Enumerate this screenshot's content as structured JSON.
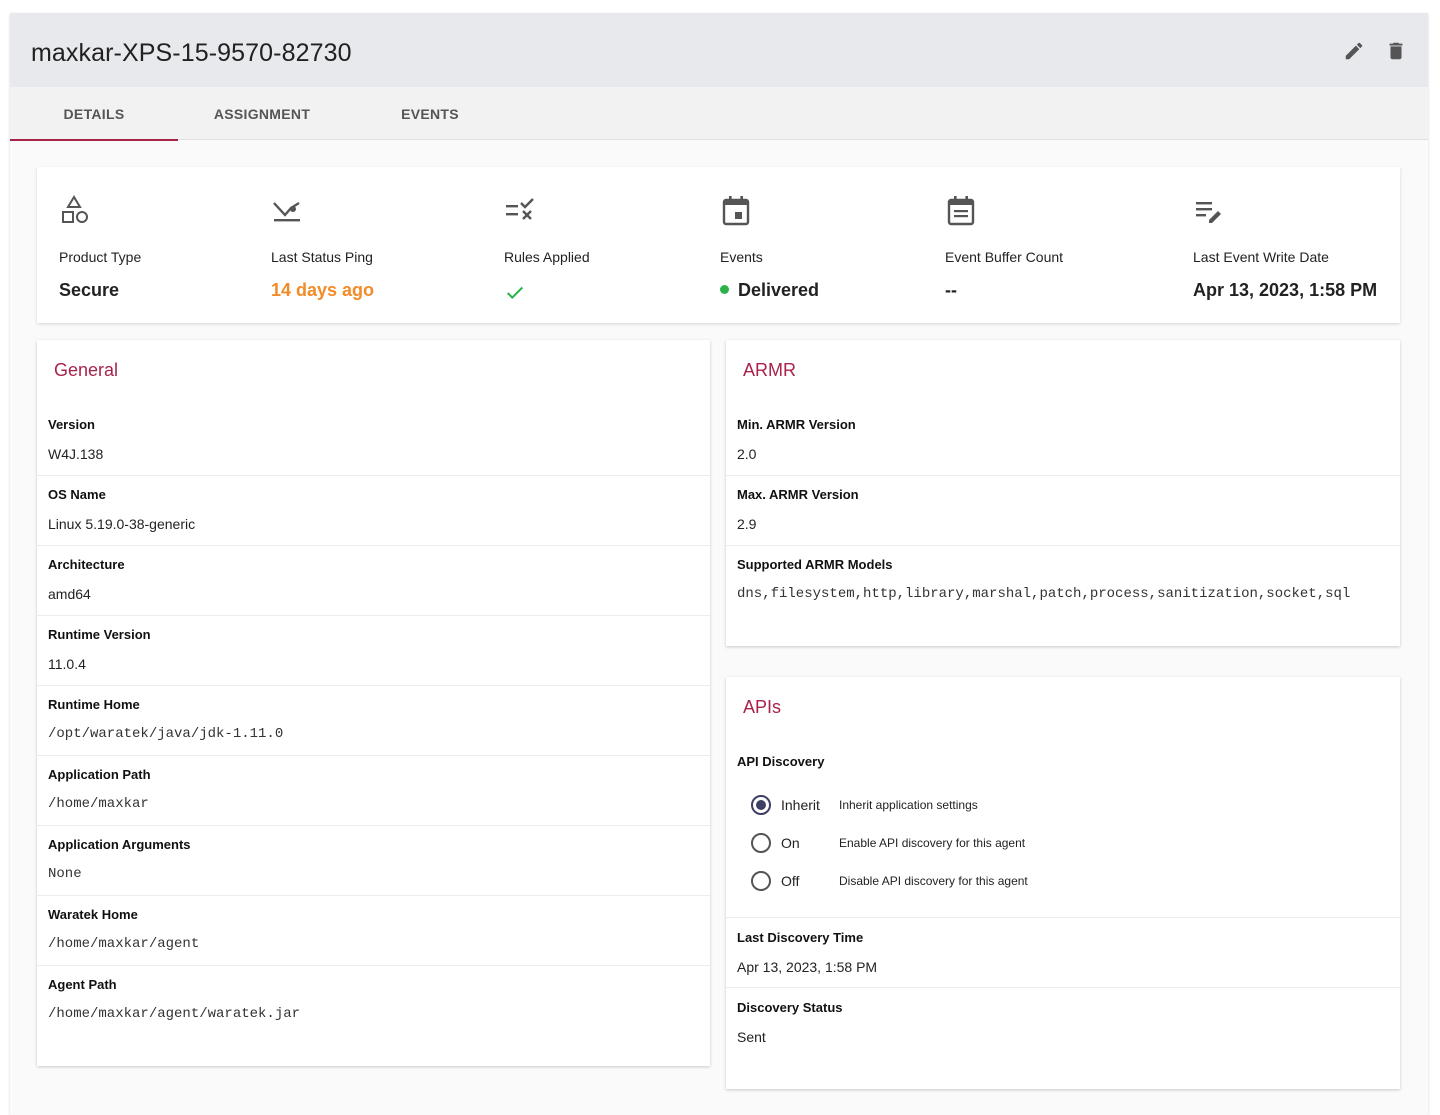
{
  "header": {
    "title": "maxkar-XPS-15-9570-82730",
    "edit_icon": "pencil-icon",
    "delete_icon": "trash-icon"
  },
  "tabs": [
    {
      "label": "DETAILS",
      "active": true
    },
    {
      "label": "ASSIGNMENT",
      "active": false
    },
    {
      "label": "EVENTS",
      "active": false
    }
  ],
  "summary": {
    "product_type": {
      "label": "Product Type",
      "value": "Secure",
      "icon": "shapes-icon"
    },
    "last_status_ping": {
      "label": "Last Status Ping",
      "value": "14 days ago",
      "icon": "ping-icon",
      "color": "#f28c28"
    },
    "rules_applied": {
      "label": "Rules Applied",
      "icon": "rule-list-icon",
      "value_icon": "checkmark-icon",
      "color": "#2bb34a"
    },
    "events": {
      "label": "Events",
      "value": "Delivered",
      "icon": "calendar-icon",
      "status_color": "#2bb34a"
    },
    "event_buffer_count": {
      "label": "Event Buffer Count",
      "value": "--",
      "icon": "calendar-list-icon"
    },
    "last_event_write_date": {
      "label": "Last Event Write Date",
      "value": "Apr 13, 2023, 1:58 PM",
      "icon": "edit-list-icon"
    }
  },
  "general": {
    "title": "General",
    "fields": [
      {
        "label": "Version",
        "value": "W4J.138"
      },
      {
        "label": "OS Name",
        "value": "Linux 5.19.0-38-generic"
      },
      {
        "label": "Architecture",
        "value": "amd64"
      },
      {
        "label": "Runtime Version",
        "value": "11.0.4"
      },
      {
        "label": "Runtime Home",
        "value": "/opt/waratek/java/jdk-1.11.0"
      },
      {
        "label": "Application Path",
        "value": "/home/maxkar"
      },
      {
        "label": "Application Arguments",
        "value": "None"
      },
      {
        "label": "Waratek Home",
        "value": "/home/maxkar/agent"
      },
      {
        "label": "Agent Path",
        "value": "/home/maxkar/agent/waratek.jar"
      }
    ]
  },
  "armr": {
    "title": "ARMR",
    "fields": [
      {
        "label": "Min. ARMR Version",
        "value": "2.0"
      },
      {
        "label": "Max. ARMR Version",
        "value": "2.9"
      },
      {
        "label": "Supported ARMR Models",
        "value": "dns,filesystem,http,library,marshal,patch,process,sanitization,socket,sql"
      }
    ]
  },
  "apis": {
    "title": "APIs",
    "api_discovery_label": "API Discovery",
    "options": [
      {
        "label": "Inherit",
        "description": "Inherit application settings",
        "checked": true
      },
      {
        "label": "On",
        "description": "Enable API discovery for this agent",
        "checked": false
      },
      {
        "label": "Off",
        "description": "Disable API discovery for this agent",
        "checked": false
      }
    ],
    "last_discovery_time": {
      "label": "Last Discovery Time",
      "value": "Apr 13, 2023, 1:58 PM"
    },
    "discovery_status": {
      "label": "Discovery Status",
      "value": "Sent"
    }
  },
  "colors": {
    "accent": "#a8234a",
    "radio": "#3d3f64",
    "success": "#2bb34a",
    "warning": "#f28c28"
  }
}
